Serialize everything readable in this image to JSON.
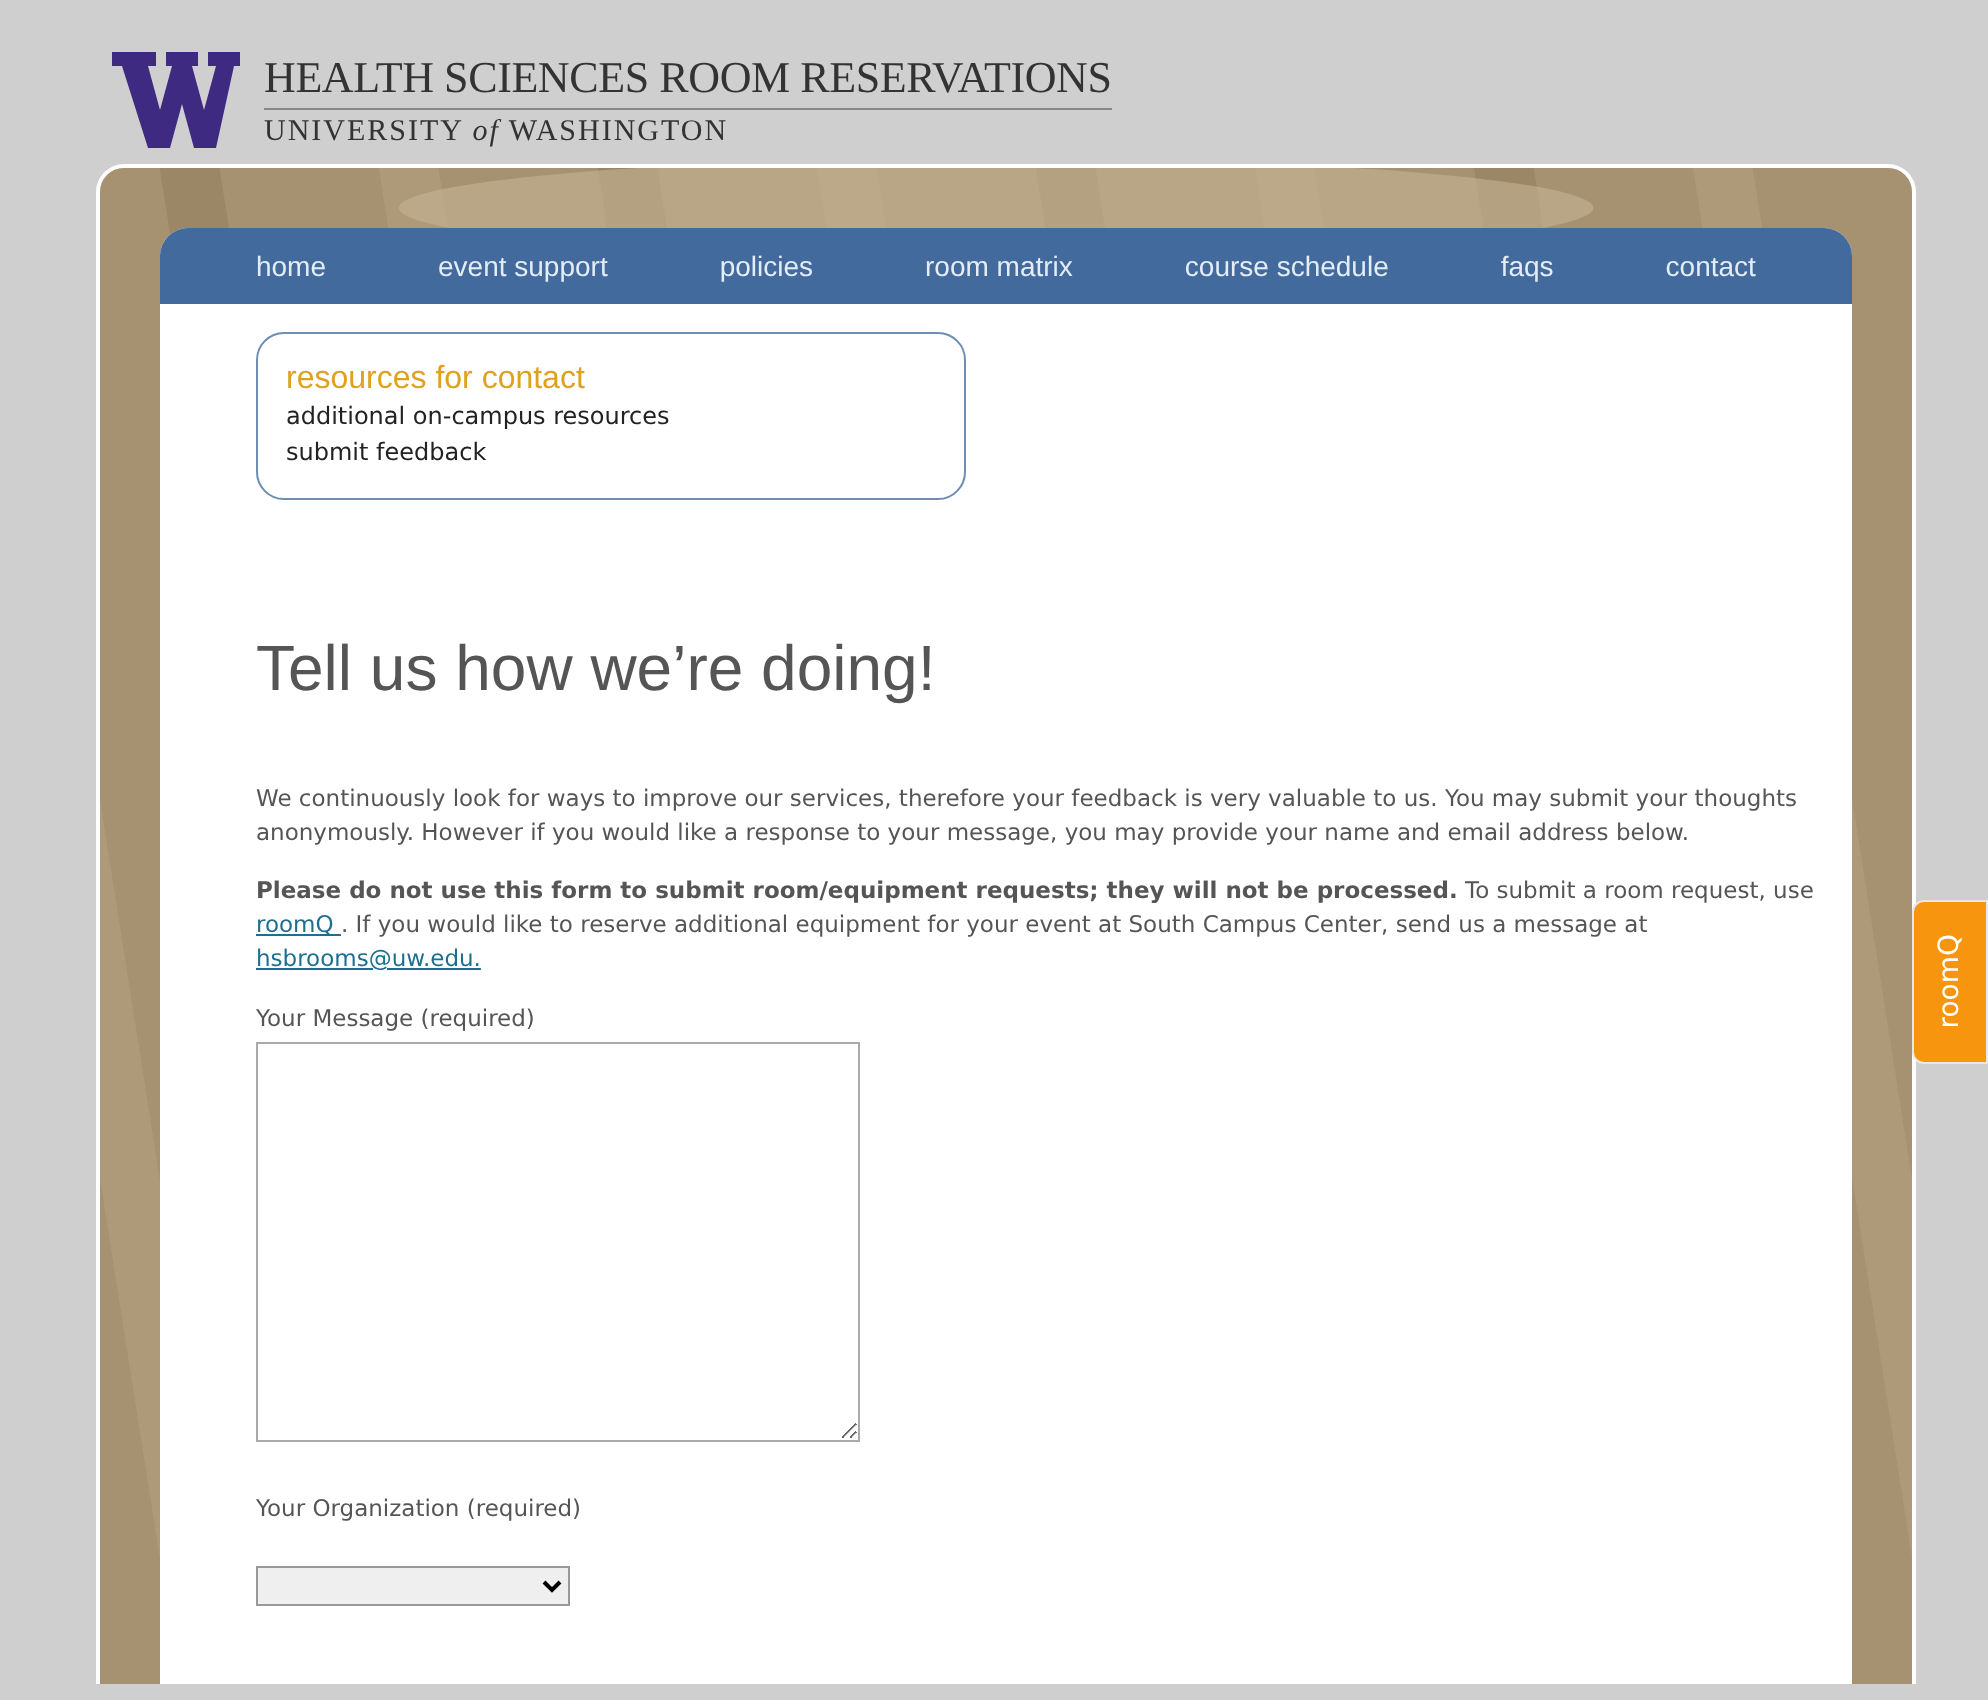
{
  "header": {
    "title": "HEALTH SCIENCES ROOM RESERVATIONS",
    "subtitle": "UNIVERSITY *of* WASHINGTON"
  },
  "nav": [
    {
      "label": "home"
    },
    {
      "label": "event support"
    },
    {
      "label": "policies"
    },
    {
      "label": "room matrix"
    },
    {
      "label": "course schedule"
    },
    {
      "label": "faqs"
    },
    {
      "label": "contact"
    }
  ],
  "sidebar": {
    "title": "resources for contact",
    "items": [
      "additional on-campus resources",
      "submit feedback"
    ]
  },
  "heading": "Tell us how we’re doing!",
  "intro": "We continuously look for ways to improve our services, therefore your feedback is very valuable to us. You may submit your thoughts anonymously. However if you would like a response to your message, you may provide your name and email address below.",
  "notice": {
    "bold": "Please do not use this form to submit room/equipment requests; they will not be processed.",
    "before_link": " To submit a room request, use ",
    "link": "roomQ ",
    "middle": ". If you would like to reserve additional equipment for your event at South Campus Center, send us a message at ",
    "email": "hsbrooms@uw.edu."
  },
  "form": {
    "message_label": "Your Message (required)",
    "organization_label": "Your Organization (required)"
  },
  "side_tab": "roomQ"
}
